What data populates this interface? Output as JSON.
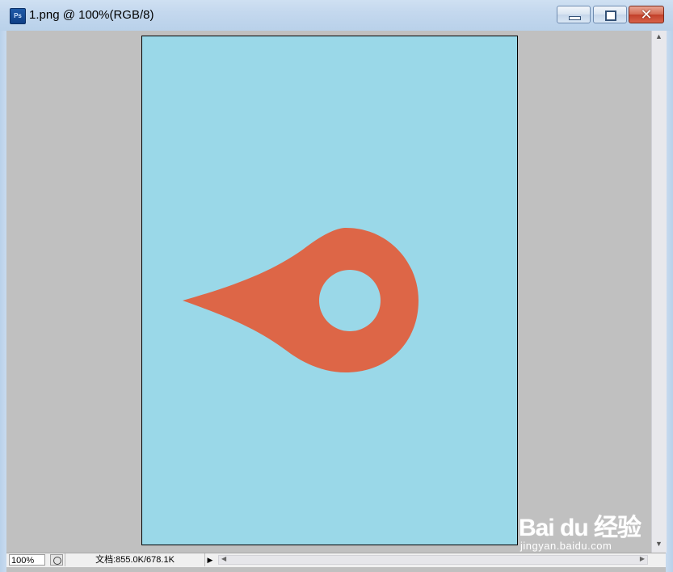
{
  "window": {
    "title": "1.png @ 100%(RGB/8)",
    "app_icon_label": "Ps",
    "minimize_label": "minimize",
    "maximize_label": "maximize",
    "close_label": "✕"
  },
  "canvas": {
    "background_color": "#9ad8e8",
    "shape_color": "#dd6647",
    "shape_icon": "location-pin-icon"
  },
  "statusbar": {
    "zoom": "100%",
    "doc_info": "文档:855.0K/678.1K",
    "menu_arrow": "▶"
  },
  "watermark": {
    "logo": "Bai du 经验",
    "url": "jingyan.baidu.com"
  }
}
